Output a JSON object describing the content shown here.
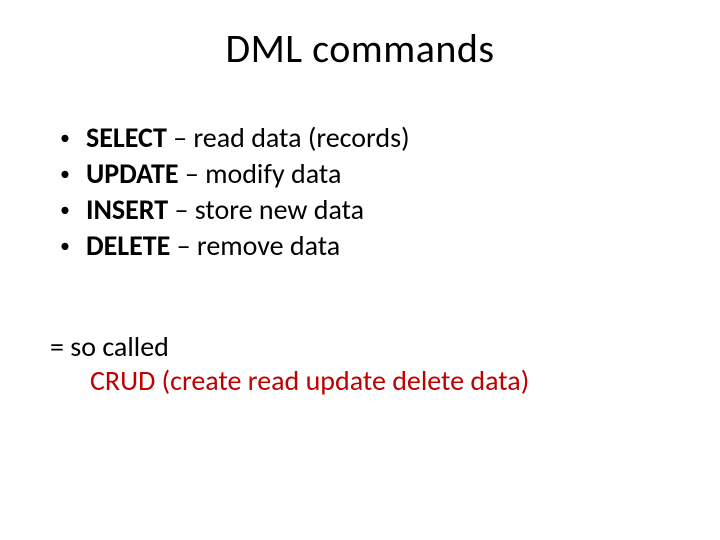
{
  "title": "DML commands",
  "bullets": [
    {
      "bold": "SELECT",
      "rest": " – read data (records)"
    },
    {
      "bold": "UPDATE",
      "rest": " – modify data"
    },
    {
      "bold": "INSERT",
      "rest": " – store new data"
    },
    {
      "bold": "DELETE",
      "rest": " – remove data"
    }
  ],
  "footer": {
    "line1": "= so called",
    "line2": "CRUD (create read update delete data)"
  }
}
